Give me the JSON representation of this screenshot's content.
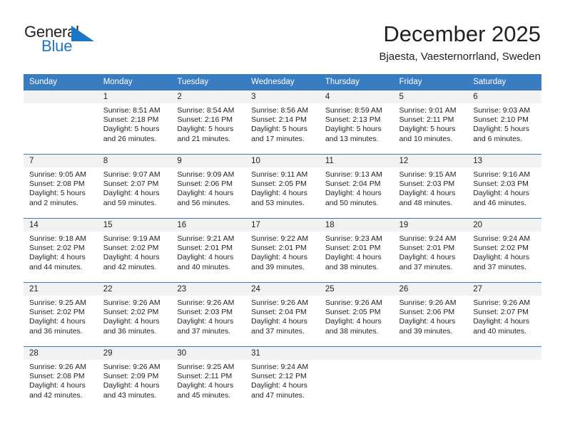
{
  "brand": {
    "name_part1": "General",
    "name_part2": "Blue",
    "flag_icon": "blue-triangle-flag-icon",
    "accent_color": "#1b77c4"
  },
  "header": {
    "month_title": "December 2025",
    "location": "Bjaesta, Vaesternorrland, Sweden"
  },
  "calendar": {
    "header_color": "#3a7cc0",
    "weekday_headers": [
      "Sunday",
      "Monday",
      "Tuesday",
      "Wednesday",
      "Thursday",
      "Friday",
      "Saturday"
    ],
    "weeks": [
      [
        {
          "day": "",
          "lines": []
        },
        {
          "day": "1",
          "lines": [
            "Sunrise: 8:51 AM",
            "Sunset: 2:18 PM",
            "Daylight: 5 hours",
            "and 26 minutes."
          ]
        },
        {
          "day": "2",
          "lines": [
            "Sunrise: 8:54 AM",
            "Sunset: 2:16 PM",
            "Daylight: 5 hours",
            "and 21 minutes."
          ]
        },
        {
          "day": "3",
          "lines": [
            "Sunrise: 8:56 AM",
            "Sunset: 2:14 PM",
            "Daylight: 5 hours",
            "and 17 minutes."
          ]
        },
        {
          "day": "4",
          "lines": [
            "Sunrise: 8:59 AM",
            "Sunset: 2:13 PM",
            "Daylight: 5 hours",
            "and 13 minutes."
          ]
        },
        {
          "day": "5",
          "lines": [
            "Sunrise: 9:01 AM",
            "Sunset: 2:11 PM",
            "Daylight: 5 hours",
            "and 10 minutes."
          ]
        },
        {
          "day": "6",
          "lines": [
            "Sunrise: 9:03 AM",
            "Sunset: 2:10 PM",
            "Daylight: 5 hours",
            "and 6 minutes."
          ]
        }
      ],
      [
        {
          "day": "7",
          "lines": [
            "Sunrise: 9:05 AM",
            "Sunset: 2:08 PM",
            "Daylight: 5 hours",
            "and 2 minutes."
          ]
        },
        {
          "day": "8",
          "lines": [
            "Sunrise: 9:07 AM",
            "Sunset: 2:07 PM",
            "Daylight: 4 hours",
            "and 59 minutes."
          ]
        },
        {
          "day": "9",
          "lines": [
            "Sunrise: 9:09 AM",
            "Sunset: 2:06 PM",
            "Daylight: 4 hours",
            "and 56 minutes."
          ]
        },
        {
          "day": "10",
          "lines": [
            "Sunrise: 9:11 AM",
            "Sunset: 2:05 PM",
            "Daylight: 4 hours",
            "and 53 minutes."
          ]
        },
        {
          "day": "11",
          "lines": [
            "Sunrise: 9:13 AM",
            "Sunset: 2:04 PM",
            "Daylight: 4 hours",
            "and 50 minutes."
          ]
        },
        {
          "day": "12",
          "lines": [
            "Sunrise: 9:15 AM",
            "Sunset: 2:03 PM",
            "Daylight: 4 hours",
            "and 48 minutes."
          ]
        },
        {
          "day": "13",
          "lines": [
            "Sunrise: 9:16 AM",
            "Sunset: 2:03 PM",
            "Daylight: 4 hours",
            "and 46 minutes."
          ]
        }
      ],
      [
        {
          "day": "14",
          "lines": [
            "Sunrise: 9:18 AM",
            "Sunset: 2:02 PM",
            "Daylight: 4 hours",
            "and 44 minutes."
          ]
        },
        {
          "day": "15",
          "lines": [
            "Sunrise: 9:19 AM",
            "Sunset: 2:02 PM",
            "Daylight: 4 hours",
            "and 42 minutes."
          ]
        },
        {
          "day": "16",
          "lines": [
            "Sunrise: 9:21 AM",
            "Sunset: 2:01 PM",
            "Daylight: 4 hours",
            "and 40 minutes."
          ]
        },
        {
          "day": "17",
          "lines": [
            "Sunrise: 9:22 AM",
            "Sunset: 2:01 PM",
            "Daylight: 4 hours",
            "and 39 minutes."
          ]
        },
        {
          "day": "18",
          "lines": [
            "Sunrise: 9:23 AM",
            "Sunset: 2:01 PM",
            "Daylight: 4 hours",
            "and 38 minutes."
          ]
        },
        {
          "day": "19",
          "lines": [
            "Sunrise: 9:24 AM",
            "Sunset: 2:01 PM",
            "Daylight: 4 hours",
            "and 37 minutes."
          ]
        },
        {
          "day": "20",
          "lines": [
            "Sunrise: 9:24 AM",
            "Sunset: 2:02 PM",
            "Daylight: 4 hours",
            "and 37 minutes."
          ]
        }
      ],
      [
        {
          "day": "21",
          "lines": [
            "Sunrise: 9:25 AM",
            "Sunset: 2:02 PM",
            "Daylight: 4 hours",
            "and 36 minutes."
          ]
        },
        {
          "day": "22",
          "lines": [
            "Sunrise: 9:26 AM",
            "Sunset: 2:02 PM",
            "Daylight: 4 hours",
            "and 36 minutes."
          ]
        },
        {
          "day": "23",
          "lines": [
            "Sunrise: 9:26 AM",
            "Sunset: 2:03 PM",
            "Daylight: 4 hours",
            "and 37 minutes."
          ]
        },
        {
          "day": "24",
          "lines": [
            "Sunrise: 9:26 AM",
            "Sunset: 2:04 PM",
            "Daylight: 4 hours",
            "and 37 minutes."
          ]
        },
        {
          "day": "25",
          "lines": [
            "Sunrise: 9:26 AM",
            "Sunset: 2:05 PM",
            "Daylight: 4 hours",
            "and 38 minutes."
          ]
        },
        {
          "day": "26",
          "lines": [
            "Sunrise: 9:26 AM",
            "Sunset: 2:06 PM",
            "Daylight: 4 hours",
            "and 39 minutes."
          ]
        },
        {
          "day": "27",
          "lines": [
            "Sunrise: 9:26 AM",
            "Sunset: 2:07 PM",
            "Daylight: 4 hours",
            "and 40 minutes."
          ]
        }
      ],
      [
        {
          "day": "28",
          "lines": [
            "Sunrise: 9:26 AM",
            "Sunset: 2:08 PM",
            "Daylight: 4 hours",
            "and 42 minutes."
          ]
        },
        {
          "day": "29",
          "lines": [
            "Sunrise: 9:26 AM",
            "Sunset: 2:09 PM",
            "Daylight: 4 hours",
            "and 43 minutes."
          ]
        },
        {
          "day": "30",
          "lines": [
            "Sunrise: 9:25 AM",
            "Sunset: 2:11 PM",
            "Daylight: 4 hours",
            "and 45 minutes."
          ]
        },
        {
          "day": "31",
          "lines": [
            "Sunrise: 9:24 AM",
            "Sunset: 2:12 PM",
            "Daylight: 4 hours",
            "and 47 minutes."
          ]
        },
        {
          "day": "",
          "lines": []
        },
        {
          "day": "",
          "lines": []
        },
        {
          "day": "",
          "lines": []
        }
      ]
    ]
  }
}
